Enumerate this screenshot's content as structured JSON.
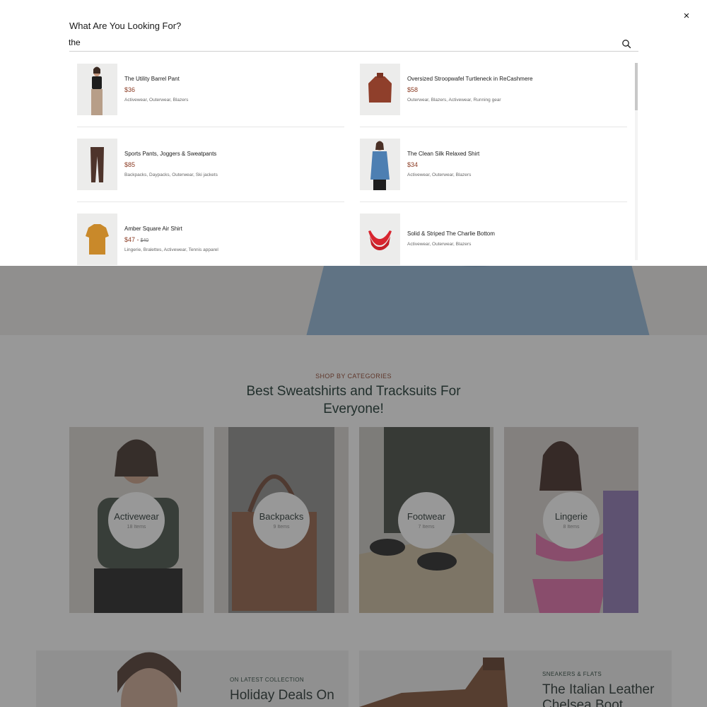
{
  "search": {
    "heading": "What Are You Looking For?",
    "query": "the",
    "close_label": "×"
  },
  "results": [
    {
      "name": "The Utility Barrel Pant",
      "price": "$36",
      "old_price": "",
      "tags": "Activewear, Outerwear, Blazers"
    },
    {
      "name": "Oversized Stroopwafel Turtleneck in ReCashmere",
      "price": "$58",
      "old_price": "",
      "tags": "Outerwear, Blazers, Activewear, Running gear"
    },
    {
      "name": "Sports Pants, Joggers & Sweatpants",
      "price": "$85",
      "old_price": "",
      "tags": "Backpacks, Daypacks, Outerwear, Ski jackets"
    },
    {
      "name": "The Clean Silk Relaxed Shirt",
      "price": "$34",
      "old_price": "",
      "tags": "Activewear, Outerwear, Blazers"
    },
    {
      "name": "Amber Square Air Shirt",
      "price": "$47 -",
      "old_price": "$40",
      "tags": "Lingerie, Bralettes, Activewear, Tennis apparel"
    },
    {
      "name": "Solid & Striped The Charlie Bottom",
      "price": "",
      "old_price": "",
      "tags": "Activewear, Outerwear, Blazers"
    }
  ],
  "categories_section": {
    "eyebrow": "SHOP BY CATEGORIES",
    "heading": "Best Sweatshirts and Tracksuits For Everyone!",
    "items": [
      {
        "name": "Activewear",
        "count": "18 Items"
      },
      {
        "name": "Backpacks",
        "count": "9 Items"
      },
      {
        "name": "Footwear",
        "count": "7 Items"
      },
      {
        "name": "Lingerie",
        "count": "8 Items"
      }
    ]
  },
  "promos": [
    {
      "eyebrow": "ON LATEST COLLECTION",
      "title": "Holiday Deals On"
    },
    {
      "eyebrow": "SNEAKERS & FLATS",
      "title": "The Italian Leather Chelsea Boot"
    }
  ],
  "colors": {
    "accent_price": "#8a3a22",
    "heading_dark": "#0f2a24",
    "overlay": "rgba(50,50,50,0.5)"
  }
}
